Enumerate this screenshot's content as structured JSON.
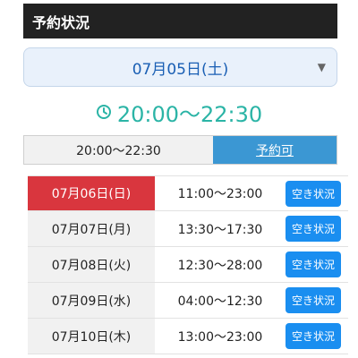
{
  "header": {
    "title": "予約状況"
  },
  "date_select": {
    "selected": "07月05日(土)"
  },
  "time_heading": {
    "time": "20:00〜22:30"
  },
  "slot": {
    "time": "20:00〜22:30",
    "status": "予約可"
  },
  "schedule": [
    {
      "date": "07月06日(日)",
      "hours": "11:00〜23:00",
      "button": "空き状況"
    },
    {
      "date": "07月07日(月)",
      "hours": "13:30〜17:30",
      "button": "空き状況"
    },
    {
      "date": "07月08日(火)",
      "hours": "12:30〜28:00",
      "button": "空き状況"
    },
    {
      "date": "07月09日(水)",
      "hours": "04:00〜12:30",
      "button": "空き状況"
    },
    {
      "date": "07月10日(木)",
      "hours": "13:00〜23:00",
      "button": "空き状況"
    }
  ],
  "colors": {
    "header_bg": "#222222",
    "teal": "#2bb4a6",
    "status_blue": "#3b97d3",
    "button_blue": "#1a8ef0",
    "highlight_red": "#d9363e"
  }
}
